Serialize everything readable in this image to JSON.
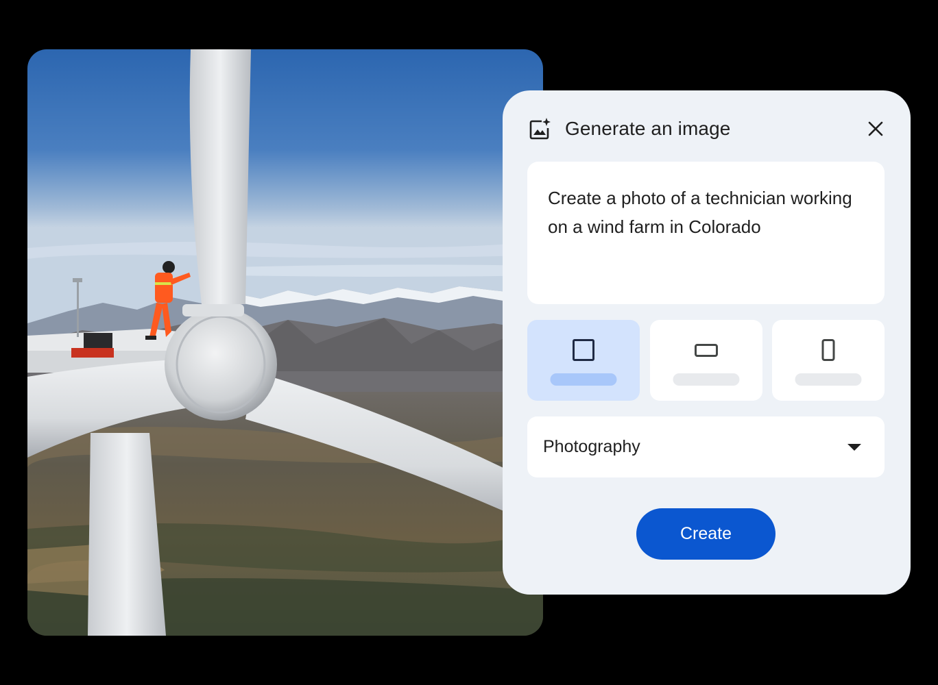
{
  "dialog": {
    "title": "Generate an image",
    "header_icon": "image-sparkle-icon",
    "close_icon": "close-icon",
    "prompt_text": "Create a photo of a technician working on a wind farm in Colorado",
    "aspect_ratios": [
      {
        "shape": "square",
        "selected": true
      },
      {
        "shape": "landscape",
        "selected": false
      },
      {
        "shape": "portrait",
        "selected": false
      }
    ],
    "style_value": "Photography",
    "create_label": "Create"
  },
  "colors": {
    "accent": "#0b57d0",
    "selected_option_bg": "#d3e3fd",
    "selected_option_bar": "#a8c7fa",
    "dialog_bg": "#eef2f7"
  }
}
